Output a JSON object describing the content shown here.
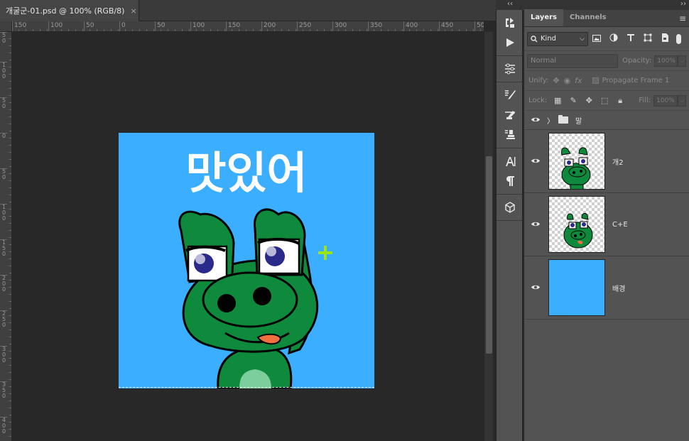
{
  "document": {
    "tab_title": "개굴군-01.psd @ 100% (RGB/8)",
    "close_glyph": "×"
  },
  "ruler": {
    "h_labels": [
      "150",
      "100",
      "50",
      "0",
      "50",
      "100",
      "150",
      "200",
      "250",
      "300",
      "350",
      "400",
      "450",
      "50"
    ],
    "v_labels": [
      "50",
      "100",
      "50",
      "0",
      "50",
      "100",
      "150",
      "200",
      "250",
      "300",
      "350",
      "400"
    ]
  },
  "canvas": {
    "artwork_text": "맛있어",
    "background_color": "#3caeff",
    "frog_color": "#0f8a3c",
    "cursor": "crosshair-plus-icon"
  },
  "toolbar": {
    "collapse_glyph": "‹‹",
    "tools": [
      "history-brush-icon",
      "play-icon",
      "adjustments-icon",
      "brush-options-icon",
      "tool-presets-icon",
      "clone-source-icon",
      "character-icon",
      "paragraph-icon",
      "3d-cube-icon"
    ]
  },
  "panel": {
    "expand_glyph": "››",
    "tabs": [
      {
        "label": "Layers",
        "active": true
      },
      {
        "label": "Channels",
        "active": false
      }
    ],
    "menu_glyph": "≡",
    "filter": {
      "kind_label": "Kind",
      "icons": [
        "image-filter-icon",
        "adjustment-filter-icon",
        "type-filter-icon",
        "shape-filter-icon",
        "smart-object-filter-icon"
      ]
    },
    "blend": {
      "mode": "Normal",
      "opacity_label": "Opacity:",
      "opacity_value": "100%"
    },
    "unify": {
      "label": "Unify:",
      "propagate_label": "Propagate Frame 1"
    },
    "lock": {
      "label": "Lock:",
      "fill_label": "Fill:",
      "fill_value": "100%"
    },
    "layers": [
      {
        "name": "말",
        "type": "group",
        "visible": true
      },
      {
        "name": "개2",
        "type": "pixel",
        "visible": true
      },
      {
        "name": "C+E",
        "type": "pixel",
        "visible": true
      },
      {
        "name": "배경",
        "type": "fill",
        "visible": true
      }
    ]
  }
}
